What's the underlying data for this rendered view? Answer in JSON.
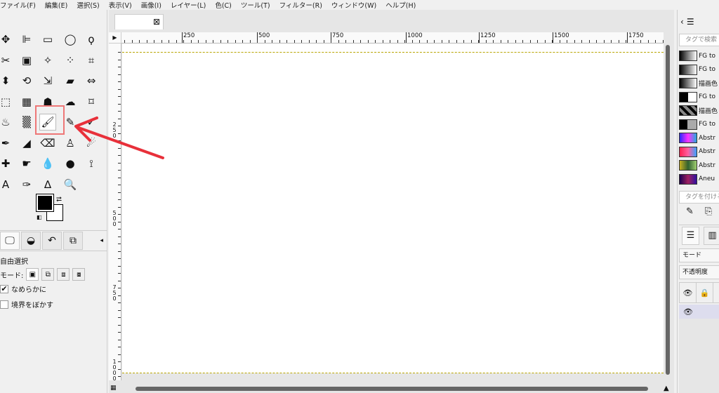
{
  "menu": [
    "ファイル(F)",
    "編集(E)",
    "選択(S)",
    "表示(V)",
    "画像(I)",
    "レイヤー(L)",
    "色(C)",
    "ツール(T)",
    "フィルター(R)",
    "ウィンドウ(W)",
    "ヘルプ(H)"
  ],
  "toolbox": {
    "tools": [
      {
        "name": "move-tool",
        "glyph": "✥"
      },
      {
        "name": "align-tool",
        "glyph": "⊫"
      },
      {
        "name": "rect-select-tool",
        "glyph": "▭"
      },
      {
        "name": "ellipse-select-tool",
        "glyph": "◯"
      },
      {
        "name": "free-select-tool",
        "glyph": "ϙ"
      },
      {
        "name": "scissors-tool",
        "glyph": "✂"
      },
      {
        "name": "foreground-select-tool",
        "glyph": "▣"
      },
      {
        "name": "fuzzy-select-tool",
        "glyph": "✧"
      },
      {
        "name": "color-select-tool",
        "glyph": "⁘"
      },
      {
        "name": "crop-tool",
        "glyph": "⌗"
      },
      {
        "name": "unified-transform-tool",
        "glyph": "⬍"
      },
      {
        "name": "rotate-tool",
        "glyph": "⟲"
      },
      {
        "name": "scale-tool",
        "glyph": "⇲"
      },
      {
        "name": "shear-tool",
        "glyph": "▰"
      },
      {
        "name": "flip-tool",
        "glyph": "⇔"
      },
      {
        "name": "perspective-tool",
        "glyph": "⬚"
      },
      {
        "name": "3d-transform-tool",
        "glyph": "▦"
      },
      {
        "name": "warp-tool",
        "glyph": "☗"
      },
      {
        "name": "handle-transform-tool",
        "glyph": "☁"
      },
      {
        "name": "cage-tool",
        "glyph": "⌑"
      },
      {
        "name": "bucket-fill-tool",
        "glyph": "♨"
      },
      {
        "name": "gradient-tool",
        "glyph": "▒"
      },
      {
        "name": "paintbrush-tool",
        "glyph": "🖌"
      },
      {
        "name": "pencil-tool",
        "glyph": "✎"
      },
      {
        "name": "mypaint-brush-tool",
        "glyph": "✓"
      },
      {
        "name": "ink-tool",
        "glyph": "✒"
      },
      {
        "name": "airbrush-tool",
        "glyph": "◢"
      },
      {
        "name": "eraser-tool",
        "glyph": "⌫"
      },
      {
        "name": "clone-tool",
        "glyph": "♙"
      },
      {
        "name": "heal-tool",
        "glyph": "☄"
      },
      {
        "name": "perspective-clone-tool",
        "glyph": "✚"
      },
      {
        "name": "smudge-tool",
        "glyph": "☛"
      },
      {
        "name": "blur-tool",
        "glyph": "💧"
      },
      {
        "name": "dodge-burn-tool",
        "glyph": "●"
      },
      {
        "name": "paths-tool",
        "glyph": "⟟"
      },
      {
        "name": "text-tool",
        "glyph": "A"
      },
      {
        "name": "color-picker-tool",
        "glyph": "✑"
      },
      {
        "name": "measure-tool",
        "glyph": "∆"
      },
      {
        "name": "zoom-tool",
        "glyph": "🔍"
      }
    ]
  },
  "tool_options": {
    "name": "自由選択",
    "mode_label": "モード:",
    "antialias_label": "なめらかに",
    "feather_label": "境界をぼかす"
  },
  "rulers": {
    "horizontal": [
      "250",
      "500",
      "750",
      "1000",
      "1250",
      "1500",
      "1750"
    ],
    "vertical": [
      "2\n5\n0",
      "5\n0\n0",
      "7\n5\n0",
      "1\n0\n0\n0"
    ]
  },
  "dock": {
    "tag_search_placeholder": "タグで検索",
    "tag_assign_placeholder": "タグを付ける",
    "gradients": [
      {
        "label": "FG to",
        "css": "linear-gradient(90deg,#000,#fff)"
      },
      {
        "label": "FG to",
        "css": "linear-gradient(90deg,#000,#fff)"
      },
      {
        "label": "描画色",
        "css": "linear-gradient(90deg,#000,#fff)"
      },
      {
        "label": "FG to",
        "css": "linear-gradient(90deg,#000 50%,#fff 50%)"
      },
      {
        "label": "描画色",
        "css": "repeating-linear-gradient(45deg,#000 0 4px,#888 4px 8px)"
      },
      {
        "label": "FG to",
        "css": "linear-gradient(90deg,#000 45%,#aaa 45%)"
      },
      {
        "label": "Abstr",
        "css": "linear-gradient(90deg,#2a2aff,#ff30ff,#2ad)"
      },
      {
        "label": "Abstr",
        "css": "linear-gradient(90deg,#ff2050,#ff60a0,#3aa0ff)"
      },
      {
        "label": "Abstr",
        "css": "linear-gradient(90deg,#c8b020,#306030,#a0d070)"
      },
      {
        "label": "Aneu",
        "css": "linear-gradient(90deg,#1a0050,#a02060,#3010a0)"
      }
    ],
    "mode_label": "モード",
    "opacity_label": "不透明度"
  }
}
